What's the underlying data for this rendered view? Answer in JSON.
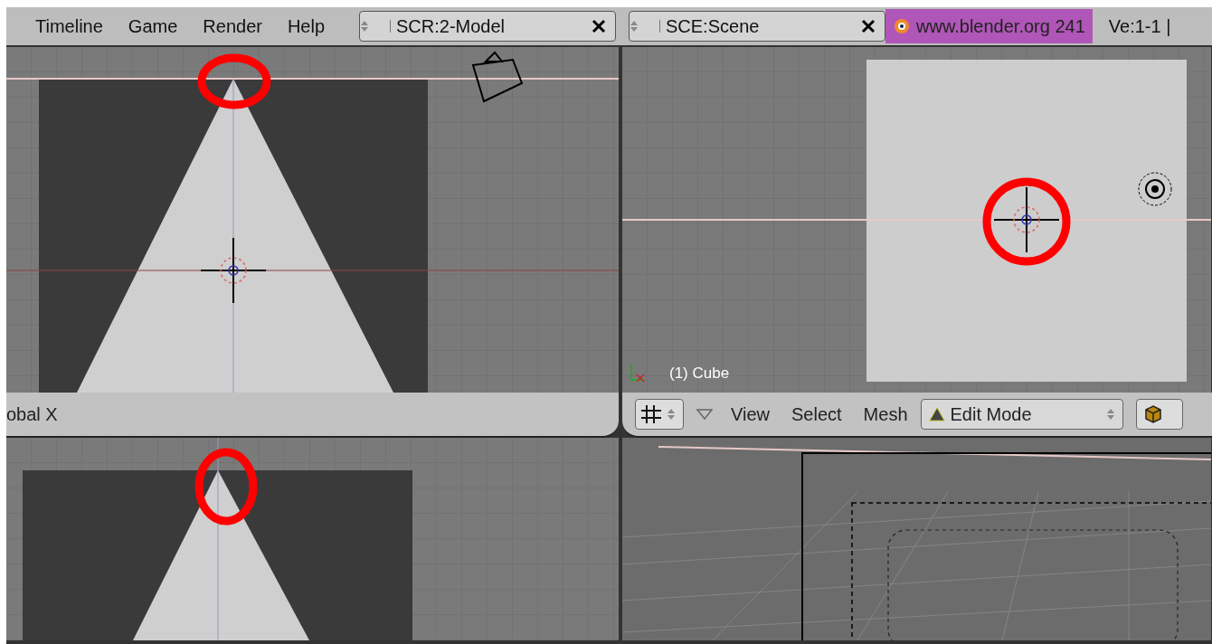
{
  "menu": [
    "Timeline",
    "Game",
    "Render",
    "Help"
  ],
  "screen_selector": {
    "value": "SCR:2-Model"
  },
  "scene_selector": {
    "value": "SCE:Scene"
  },
  "info": {
    "label": "www.blender.org 241",
    "stats": "Ve:1-1 |"
  },
  "viewports": [
    {
      "kind": "front",
      "annotated": true
    },
    {
      "kind": "top",
      "annotated": true,
      "label": "(1) Cube"
    },
    {
      "kind": "front_low",
      "annotated": true
    },
    {
      "kind": "perspective",
      "annotated": false
    }
  ],
  "left_header": {
    "text": "obal X"
  },
  "right_header": {
    "menus": [
      "View",
      "Select",
      "Mesh"
    ],
    "mode": "Edit Mode"
  }
}
